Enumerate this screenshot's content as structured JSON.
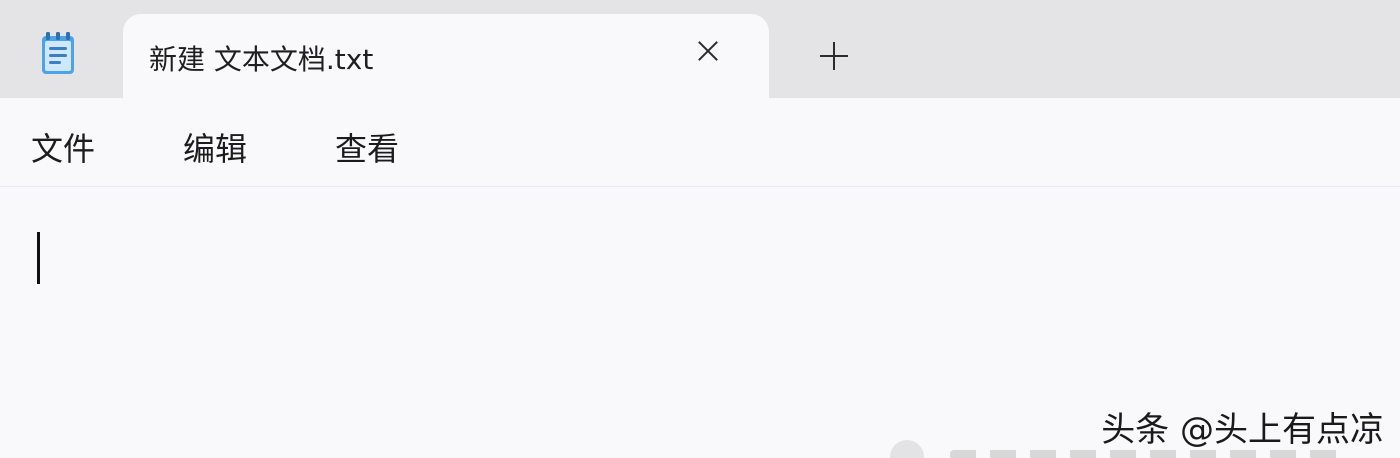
{
  "window": {
    "app_icon": "notepad-icon"
  },
  "tab": {
    "title": "新建 文本文档.txt",
    "close_icon": "close-icon"
  },
  "new_tab_icon": "plus-icon",
  "menu": {
    "file": "文件",
    "edit": "编辑",
    "view": "查看"
  },
  "editor": {
    "value": ""
  },
  "watermark": {
    "text": "头条 @头上有点凉"
  }
}
